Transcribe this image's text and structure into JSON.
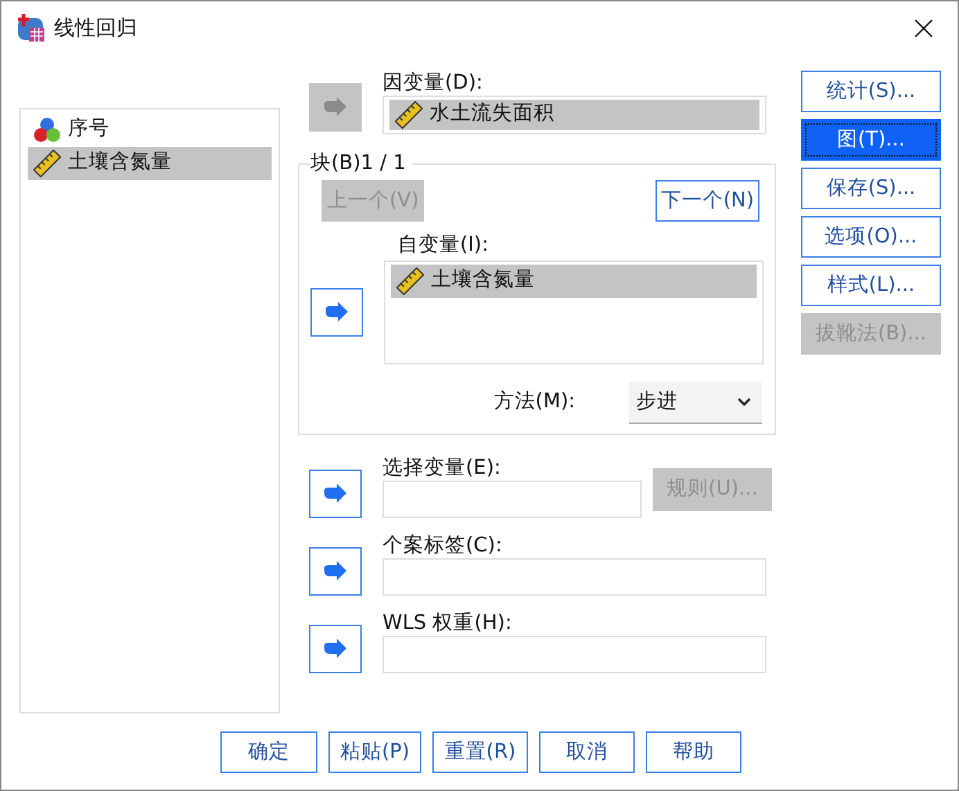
{
  "window": {
    "title": "线性回归"
  },
  "variables": [
    {
      "label": "序号",
      "kind": "nominal",
      "selected": false
    },
    {
      "label": "土壤含氮量",
      "kind": "scale",
      "selected": true
    }
  ],
  "dependent": {
    "label": "因变量(D):",
    "arrow_enabled": false,
    "items": [
      {
        "label": "水土流失面积",
        "kind": "scale",
        "selected": true
      }
    ]
  },
  "block": {
    "title": "块(B)1 / 1",
    "buttons": [
      {
        "label": "上一个(V)",
        "disabled": true
      },
      {
        "label": "下一个(N)",
        "disabled": false
      }
    ],
    "independent": {
      "label": "自变量(I):",
      "arrow_enabled": true,
      "items": [
        {
          "label": "土壤含氮量",
          "kind": "scale",
          "selected": true
        }
      ]
    },
    "method": {
      "label": "方法(M):",
      "value": "步进"
    }
  },
  "selection": {
    "label": "选择变量(E):",
    "arrow_enabled": true,
    "rule_button": {
      "label": "规则(U)...",
      "disabled": true
    }
  },
  "case_labels": {
    "label": "个案标签(C):",
    "arrow_enabled": true
  },
  "wls_weight": {
    "label": "WLS 权重(H):",
    "arrow_enabled": true
  },
  "side_buttons": [
    {
      "label": "统计(S)...",
      "focused": false,
      "disabled": false
    },
    {
      "label": "图(T)...",
      "focused": true,
      "disabled": false
    },
    {
      "label": "保存(S)...",
      "focused": false,
      "disabled": false
    },
    {
      "label": "选项(O)...",
      "focused": false,
      "disabled": false
    },
    {
      "label": "样式(L)...",
      "focused": false,
      "disabled": false
    },
    {
      "label": "拔靴法(B)...",
      "focused": false,
      "disabled": true
    }
  ],
  "footer_buttons": [
    {
      "label": "确定"
    },
    {
      "label": "粘贴(P)"
    },
    {
      "label": "重置(R)"
    },
    {
      "label": "取消"
    },
    {
      "label": "帮助"
    }
  ]
}
